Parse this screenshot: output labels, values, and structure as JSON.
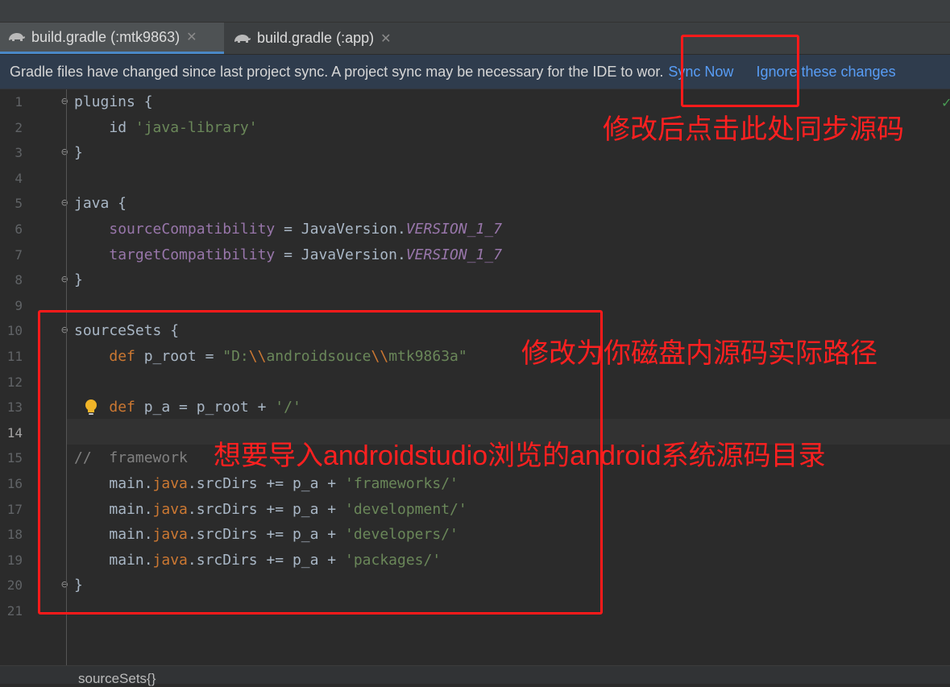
{
  "tabs": [
    {
      "label": "build.gradle (:mtk9863)",
      "icon": "gradle-icon",
      "active": true
    },
    {
      "label": "build.gradle (:app)",
      "icon": "gradle-icon",
      "active": false
    }
  ],
  "banner": {
    "message": "Gradle files have changed since last project sync. A project sync may be necessary for the IDE to wor.",
    "sync_now": "Sync Now",
    "ignore": "Ignore these changes"
  },
  "line_numbers": [
    "1",
    "2",
    "3",
    "4",
    "5",
    "6",
    "7",
    "8",
    "9",
    "10",
    "11",
    "12",
    "13",
    "14",
    "15",
    "16",
    "17",
    "18",
    "19",
    "20",
    "21"
  ],
  "code": {
    "l1_kw": "plugins {",
    "l2_id": "id ",
    "l2_str": "'java-library'",
    "l3": "}",
    "l5": "java {",
    "l6_field": "sourceCompatibility",
    "l6_mid": " = JavaVersion.",
    "l6_const": "VERSION_1_7",
    "l7_field": "targetCompatibility",
    "l7_mid": " = JavaVersion.",
    "l7_const": "VERSION_1_7",
    "l8": "}",
    "l10": "sourceSets {",
    "l11_kw": "def",
    "l11_mid": " p_root = ",
    "l11_s1": "\"D:",
    "l11_e1": "\\\\",
    "l11_s2": "androidsouce",
    "l11_e2": "\\\\",
    "l11_s3": "mtk9863a\"",
    "l13_kw": "def",
    "l13_mid": " p_a = p_root + ",
    "l13_str": "'/'",
    "l15_cmt": "//  framework",
    "src_rows": [
      {
        "pre": "main.",
        "java": "java",
        "mid": ".srcDirs += p_a + ",
        "str": "'frameworks/'"
      },
      {
        "pre": "main.",
        "java": "java",
        "mid": ".srcDirs += p_a + ",
        "str": "'development/'"
      },
      {
        "pre": "main.",
        "java": "java",
        "mid": ".srcDirs += p_a + ",
        "str": "'developers/'"
      },
      {
        "pre": "main.",
        "java": "java",
        "mid": ".srcDirs += p_a + ",
        "str": "'packages/'"
      }
    ],
    "l20": "}"
  },
  "annotations": {
    "sync": "修改后点击此处同步源码",
    "path": "修改为你磁盘内源码实际路径",
    "import": "想要导入androidstudio浏览的android系统源码目录"
  },
  "breadcrumb": "sourceSets{}",
  "colors": {
    "annotation": "#ff1a1a",
    "link": "#589df6",
    "keyword": "#cc7832",
    "string": "#6a8759",
    "field": "#9876aa"
  }
}
